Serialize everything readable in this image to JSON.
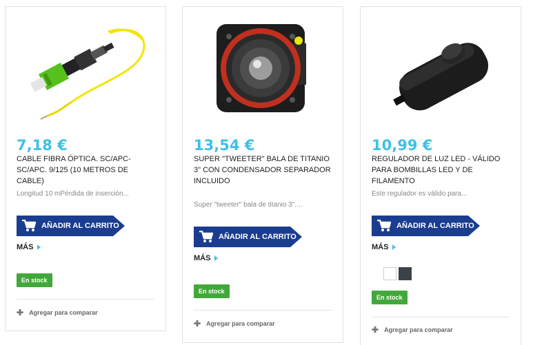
{
  "products": [
    {
      "price": "7,18 €",
      "title": "CABLE FIBRA ÓPTICA. SC/APC-SC/APC. 9/125 (10 METROS DE CABLE)",
      "description": "Longitud 10 mPérdida de inserción...",
      "cart_label": "AÑADIR AL CARRITO",
      "more_label": "MÁS",
      "stock_label": "En stock",
      "compare_label": "Agregar para comparar"
    },
    {
      "price": "13,54 €",
      "title": "SUPER \"TWEETER\" BALA DE TITANIO 3\" CON CONDENSADOR SEPARADOR INCLUIDO",
      "description": "Super \"tweeter\" bala de titanio 3\"....",
      "cart_label": "AÑADIR AL CARRITO",
      "more_label": "MÁS",
      "stock_label": "En stock",
      "compare_label": "Agregar para comparar"
    },
    {
      "price": "10,99 €",
      "title": "REGULADOR DE LUZ LED - VÁLIDO PARA BOMBILLAS LED Y DE FILAMENTO",
      "description": "Este regulador es válido para...",
      "cart_label": "AÑADIR AL CARRITO",
      "more_label": "MÁS",
      "stock_label": "En stock",
      "compare_label": "Agregar para comparar",
      "swatches": [
        "#ffffff",
        "#3d4148"
      ]
    }
  ],
  "colors": {
    "price": "#3ec0e6",
    "cart_button": "#1a3d8f",
    "stock_badge": "#43a83b"
  }
}
